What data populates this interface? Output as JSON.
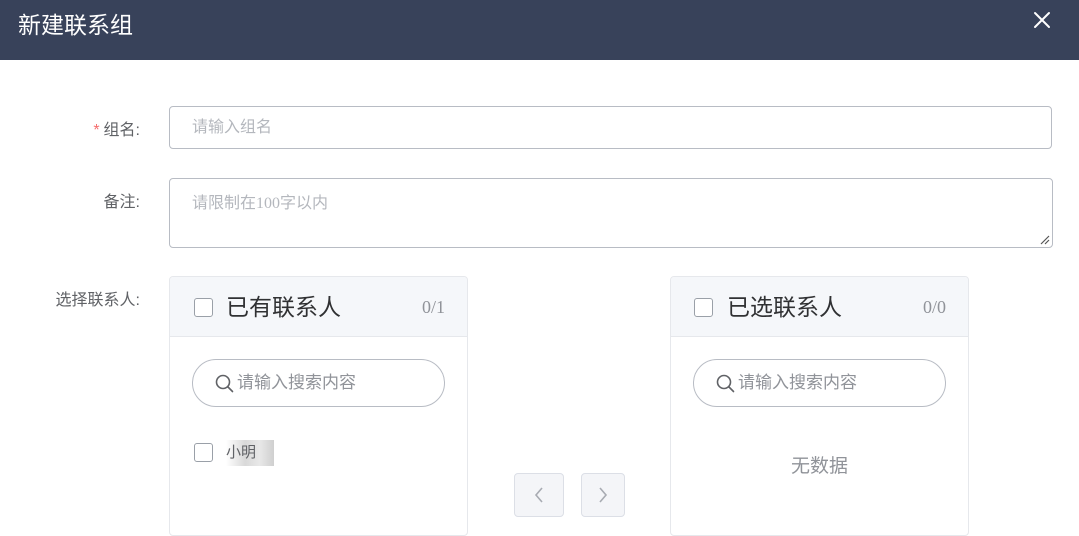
{
  "dialog": {
    "title": "新建联系组",
    "close_icon": "close-icon"
  },
  "form": {
    "group_name": {
      "required_mark": "*",
      "label": "组名:",
      "placeholder": "请输入组名",
      "value": ""
    },
    "remark": {
      "label": "备注:",
      "placeholder": "请限制在100字以内",
      "value": ""
    },
    "contacts_label": "选择联系人:"
  },
  "transfer": {
    "left": {
      "title": "已有联系人",
      "count": "0/1",
      "search_placeholder": "请输入搜索内容",
      "items": [
        {
          "name": "小明",
          "checked": false
        }
      ]
    },
    "right": {
      "title": "已选联系人",
      "count": "0/0",
      "search_placeholder": "请输入搜索内容",
      "empty_text": "无数据"
    },
    "buttons": {
      "to_left_icon": "chevron-left-icon",
      "to_right_icon": "chevron-right-icon"
    }
  },
  "colors": {
    "header_bg": "#38425a",
    "required": "#f56c6c",
    "panel_head_bg": "#f5f7fa"
  }
}
